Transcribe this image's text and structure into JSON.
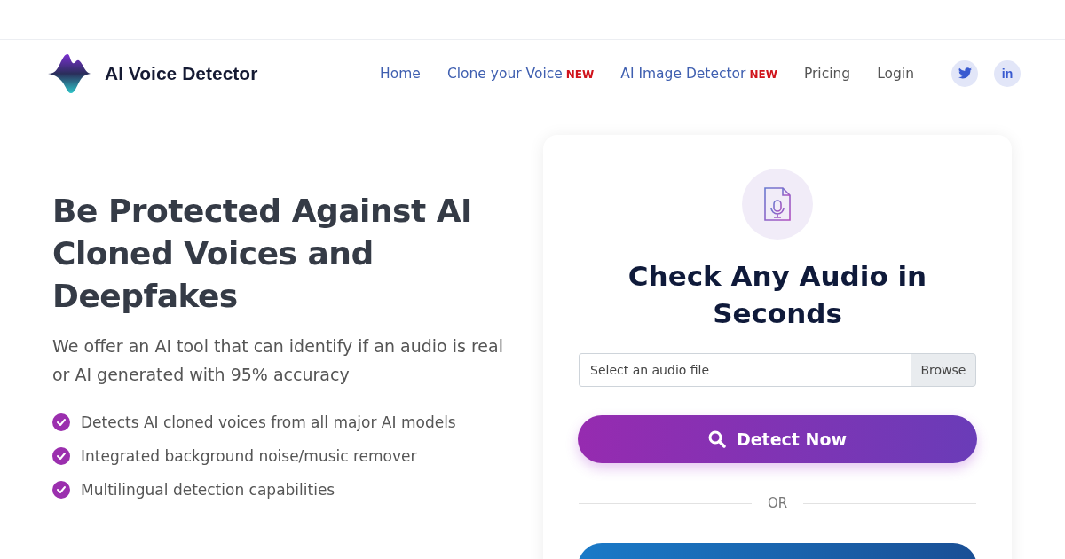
{
  "brand": {
    "name": "AI Voice Detector"
  },
  "nav": [
    {
      "label": "Home",
      "color": "#3f5fb0"
    },
    {
      "label": "Clone your Voice",
      "badge": "NEW",
      "color": "#3f5fb0"
    },
    {
      "label": "AI Image Detector",
      "badge": "NEW",
      "color": "#3f5fb0"
    },
    {
      "label": "Pricing",
      "color": "#555555"
    },
    {
      "label": "Login",
      "color": "#555555"
    }
  ],
  "social": [
    {
      "kind": "twitter"
    },
    {
      "kind": "linkedin",
      "label": "in"
    }
  ],
  "hero": {
    "title": "Be Protected Against AI Cloned Voices and Deepfakes",
    "subtitle": "We offer an AI tool that can identify if an audio is real or AI generated with 95% accuracy",
    "features": [
      "Detects AI cloned voices from all major AI models",
      "Integrated background noise/music remover",
      "Multilingual detection capabilities"
    ]
  },
  "card": {
    "title": "Check Any Audio in Seconds",
    "file_field": {
      "placeholder": "Select an audio file",
      "button": "Browse"
    },
    "detect_button": "Detect Now",
    "divider": "OR"
  }
}
